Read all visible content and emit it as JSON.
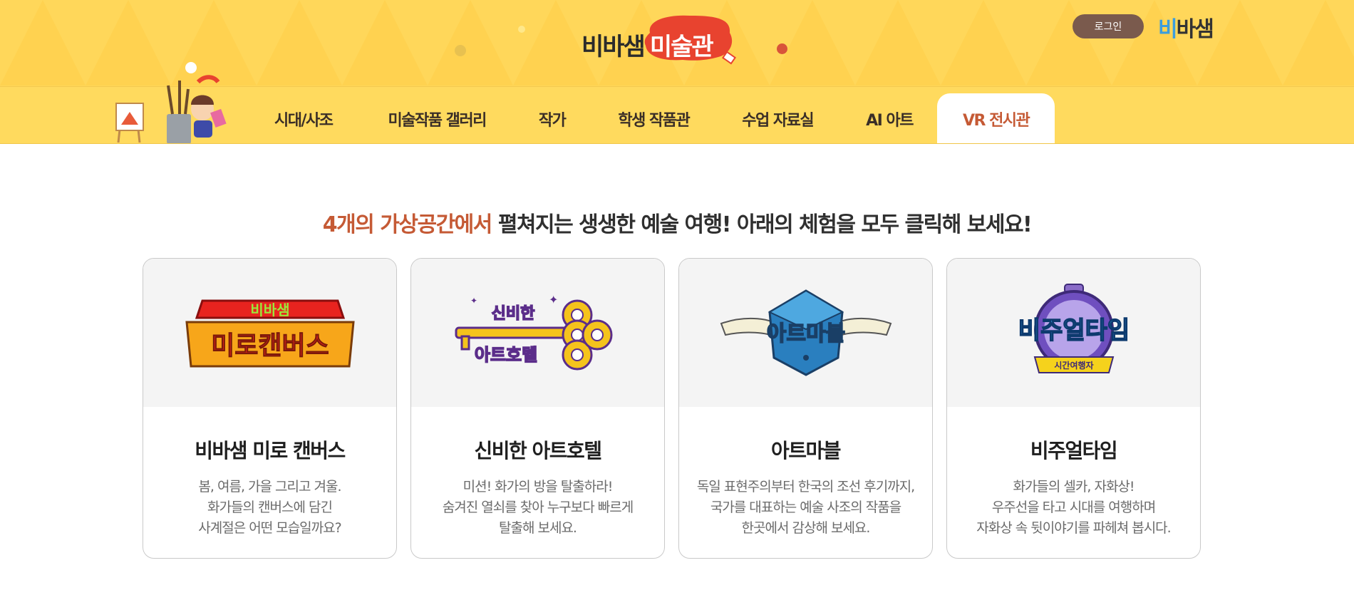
{
  "header": {
    "logo_main": "비바샘",
    "logo_badge": "미술관",
    "login_label": "로그인",
    "brand_prefix": "비",
    "brand_suffix": "바샘"
  },
  "nav": {
    "items": [
      {
        "label": "시대/사조"
      },
      {
        "label": "미술작품 갤러리"
      },
      {
        "label": "작가"
      },
      {
        "label": "학생 작품관"
      },
      {
        "label": "수업 자료실"
      },
      {
        "label": "AI 아트"
      },
      {
        "label": "VR 전시관",
        "active": true
      }
    ]
  },
  "headline": {
    "highlight": "4개의 가상공간에서",
    "rest": " 펼쳐지는 생생한 예술 여행! 아래의 체험을 모두 클릭해 보세요!"
  },
  "cards": [
    {
      "title": "비바샘 미로 캔버스",
      "logo_top": "비바샘",
      "logo_bottom": "미로캔버스",
      "desc": [
        "봄, 여름, 가을 그리고 겨울.",
        "화가들의 캔버스에 담긴",
        "사계절은 어떤 모습일까요?"
      ]
    },
    {
      "title": "신비한 아트호텔",
      "logo_top": "신비한",
      "logo_bottom": "아트호텔",
      "desc": [
        "미션! 화가의 방을 탈출하라!",
        "숨겨진 열쇠를 찾아 누구보다 빠르게",
        "탈출해 보세요."
      ]
    },
    {
      "title": "아트마블",
      "logo_top": "아트마블",
      "desc": [
        "독일 표현주의부터 한국의 조선 후기까지,",
        "국가를 대표하는 예술 사조의 작품을",
        "한곳에서 감상해 보세요."
      ]
    },
    {
      "title": "비주얼타임",
      "logo_top": "비주얼타임",
      "logo_bottom": "시간여행자",
      "desc": [
        "화가들의 셀카, 자화상!",
        "우주선을 타고 시대를 여행하며",
        "자화상 속 뒷이야기를 파헤쳐 봅시다."
      ]
    }
  ],
  "colors": {
    "header_bg": "#ffd75a",
    "accent": "#c55a35",
    "login_bg": "#7a5a4d"
  }
}
